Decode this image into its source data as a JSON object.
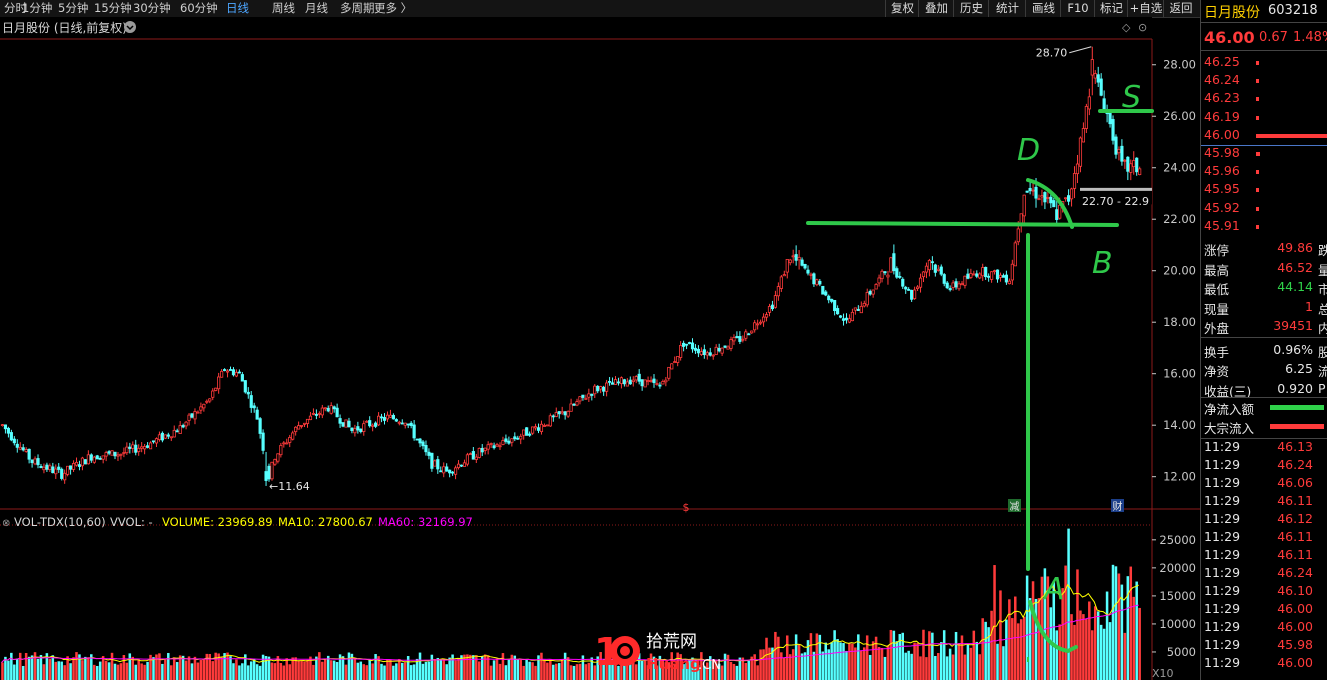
{
  "toolbar": {
    "periods": [
      "分时",
      "1分钟",
      "5分钟",
      "15分钟",
      "30分钟",
      "60分钟",
      "日线",
      "周线",
      "月线",
      "多周期",
      "更多 〉"
    ],
    "active_period": "日线",
    "right_buttons": [
      "复权",
      "叠加",
      "历史",
      "统计",
      "画线",
      "F10",
      "标记",
      "+自选",
      "返回"
    ]
  },
  "chart_header": {
    "title": "日月股份 (日线,前复权)"
  },
  "sidebar": {
    "stock_name": "日月股份",
    "stock_code": "603218",
    "price": "46.00",
    "change": "0.67",
    "change_pct": "1.48%",
    "order_book": [
      {
        "price": "46.25",
        "kind": "ask",
        "bar": 0.02
      },
      {
        "price": "46.24",
        "kind": "ask",
        "bar": 0.02
      },
      {
        "price": "46.23",
        "kind": "ask",
        "bar": 0.02
      },
      {
        "price": "46.19",
        "kind": "ask",
        "bar": 0.02
      },
      {
        "price": "46.00",
        "kind": "ask",
        "bar": 1.0
      },
      {
        "price": "45.98",
        "kind": "bid",
        "bar": 0.05
      },
      {
        "price": "45.96",
        "kind": "bid",
        "bar": 0.02
      },
      {
        "price": "45.95",
        "kind": "bid",
        "bar": 0.02
      },
      {
        "price": "45.92",
        "kind": "bid",
        "bar": 0.02
      },
      {
        "price": "45.91",
        "kind": "bid",
        "bar": 0.02
      }
    ],
    "stats": [
      {
        "label": "涨停",
        "value": "49.86",
        "cut": "跌",
        "color": "red"
      },
      {
        "label": "最高",
        "value": "46.52",
        "cut": "量",
        "color": "red"
      },
      {
        "label": "最低",
        "value": "44.14",
        "cut": "市",
        "color": "green"
      },
      {
        "label": "现量",
        "value": "1",
        "cut": "总",
        "color": "red"
      },
      {
        "label": "外盘",
        "value": "39451",
        "cut": "内",
        "color": "red"
      },
      {
        "label": "换手",
        "value": "0.96%",
        "cut": "股",
        "color": "white"
      },
      {
        "label": "净资",
        "value": "6.25",
        "cut": "流",
        "color": "white"
      },
      {
        "label": "收益(三)",
        "value": "0.920",
        "cut": "P",
        "color": "white"
      }
    ],
    "flows": [
      {
        "label": "净流入额",
        "color": "#2fd24a"
      },
      {
        "label": "大宗流入",
        "color": "#ff3b3b"
      }
    ],
    "ticks": [
      {
        "time": "11:29",
        "price": "46.13"
      },
      {
        "time": "11:29",
        "price": "46.24"
      },
      {
        "time": "11:29",
        "price": "46.06"
      },
      {
        "time": "11:29",
        "price": "46.11"
      },
      {
        "time": "11:29",
        "price": "46.12"
      },
      {
        "time": "11:29",
        "price": "46.11"
      },
      {
        "time": "11:29",
        "price": "46.11"
      },
      {
        "time": "11:29",
        "price": "46.24"
      },
      {
        "time": "11:29",
        "price": "46.10"
      },
      {
        "time": "11:29",
        "price": "46.00"
      },
      {
        "time": "11:29",
        "price": "46.00"
      },
      {
        "time": "11:29",
        "price": "45.98"
      },
      {
        "time": "11:29",
        "price": "46.00"
      }
    ]
  },
  "colors": {
    "up": "#ff3b3b",
    "down": "#57ffff",
    "ma10": "#ffff00",
    "ma60": "#ff00ff",
    "annot": "#2fc84a",
    "axis": "#c8c8c8",
    "grid": "#8b1a1a"
  },
  "chart_data": [
    {
      "type": "candlestick",
      "title": "日月股份 (日线,前复权)",
      "ylim": [
        10.9,
        29.0
      ],
      "y_ticks": [
        12.0,
        14.0,
        16.0,
        18.0,
        20.0,
        22.0,
        24.0,
        26.0,
        28.0
      ],
      "annotations": {
        "high_label": "28.70",
        "low_label": "11.64",
        "range_label": "22.70 - 22.9",
        "markers": [
          "$",
          "减",
          "财"
        ]
      },
      "handwritten": [
        "D",
        "B",
        "S",
        "A"
      ],
      "ohlc_anchors": [
        [
          0,
          14.0
        ],
        [
          10,
          12.6
        ],
        [
          20,
          12.1
        ],
        [
          30,
          12.8
        ],
        [
          40,
          12.9
        ],
        [
          50,
          13.3
        ],
        [
          60,
          13.9
        ],
        [
          70,
          15.0
        ],
        [
          75,
          16.2
        ],
        [
          80,
          16.0
        ],
        [
          86,
          14.3
        ],
        [
          90,
          12.0
        ],
        [
          92,
          12.8
        ],
        [
          100,
          14.0
        ],
        [
          110,
          14.7
        ],
        [
          118,
          13.8
        ],
        [
          130,
          14.3
        ],
        [
          136,
          14.2
        ],
        [
          145,
          12.5
        ],
        [
          150,
          12.2
        ],
        [
          160,
          12.9
        ],
        [
          175,
          13.6
        ],
        [
          190,
          14.5
        ],
        [
          200,
          15.4
        ],
        [
          213,
          15.8
        ],
        [
          222,
          15.5
        ],
        [
          230,
          17.2
        ],
        [
          238,
          16.8
        ],
        [
          250,
          17.4
        ],
        [
          260,
          18.7
        ],
        [
          266,
          20.6
        ],
        [
          275,
          19.5
        ],
        [
          285,
          18.0
        ],
        [
          292,
          19.0
        ],
        [
          300,
          20.3
        ],
        [
          307,
          19.0
        ],
        [
          313,
          20.5
        ],
        [
          320,
          19.3
        ],
        [
          330,
          20.0
        ],
        [
          340,
          19.7
        ],
        [
          345,
          23.2
        ],
        [
          350,
          23.0
        ],
        [
          356,
          22.2
        ],
        [
          360,
          22.8
        ],
        [
          365,
          25.5
        ],
        [
          368,
          27.8
        ],
        [
          372,
          26.5
        ],
        [
          378,
          24.0
        ],
        [
          385,
          24.0
        ]
      ],
      "n_bars": 385
    },
    {
      "type": "bar",
      "title": "VOL-TDX(10,60)",
      "series_labels": {
        "vvol": "VVOL: -",
        "volume": "VOLUME: 23969.89",
        "ma10": "MA10: 27800.67",
        "ma60": "MA60: 32169.97"
      },
      "ylim": [
        0,
        28000
      ],
      "y_ticks": [
        5000,
        10000,
        15000,
        20000,
        25000
      ],
      "scale_note": "X10"
    }
  ]
}
